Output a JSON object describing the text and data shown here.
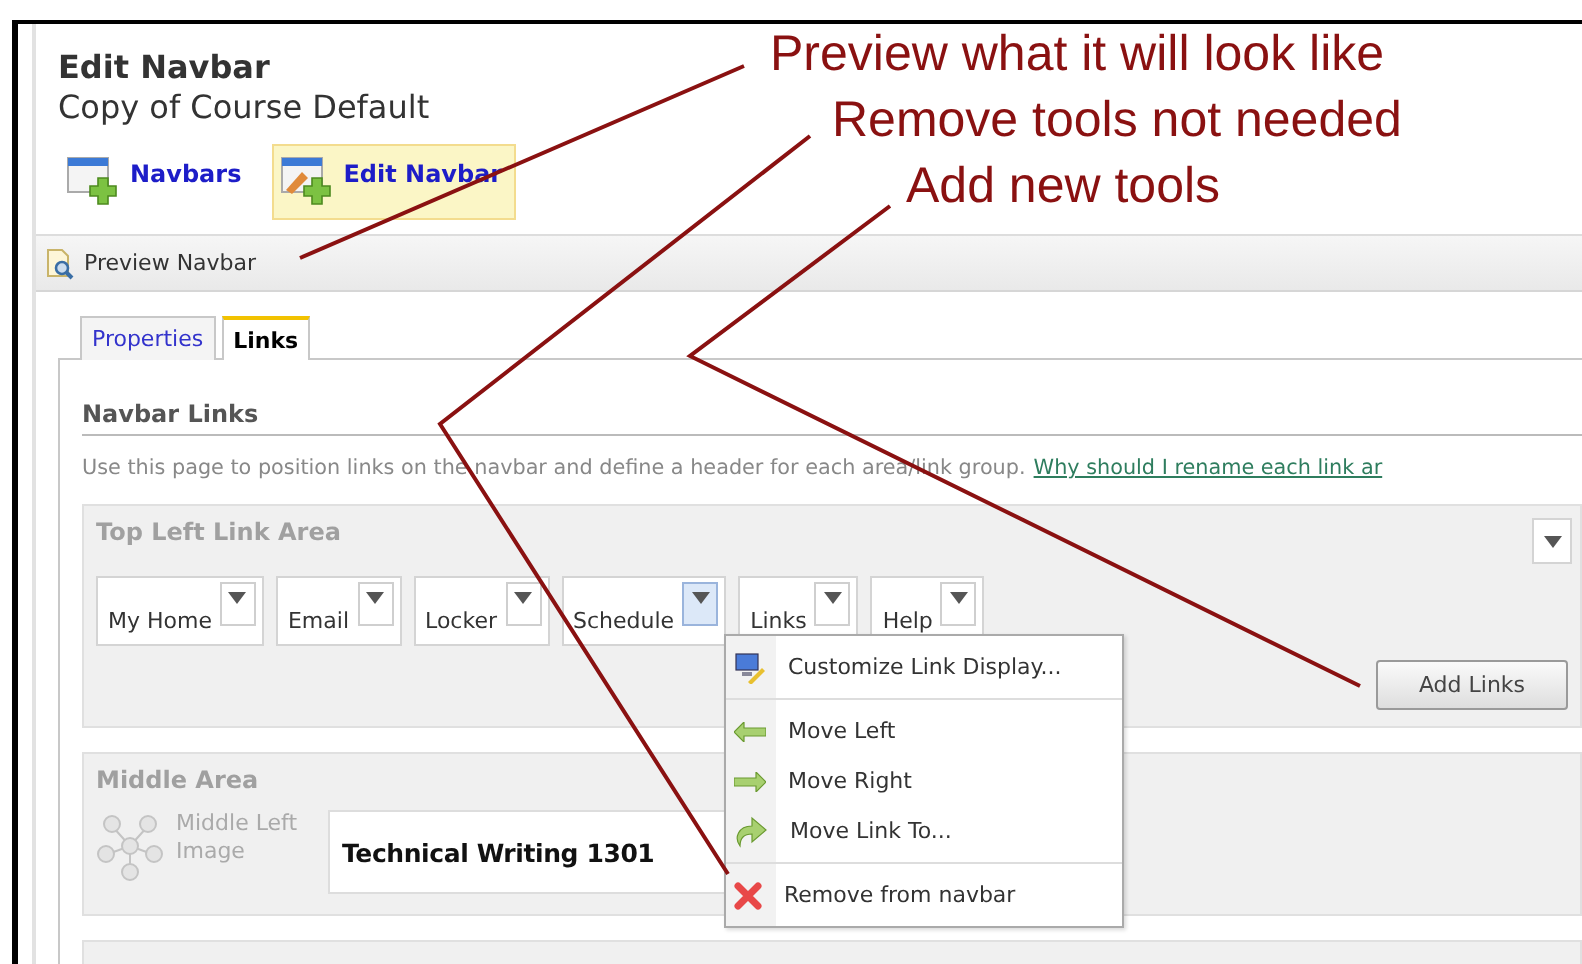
{
  "header": {
    "title": "Edit Navbar",
    "subtitle": "Copy of Course Default"
  },
  "nav_buttons": [
    {
      "label": "Navbars",
      "selected": false,
      "kind": "list"
    },
    {
      "label": "Edit Navbar",
      "selected": true,
      "kind": "edit"
    }
  ],
  "toolbar": {
    "preview": "Preview Navbar"
  },
  "tabs": [
    {
      "label": "Properties",
      "selected": false
    },
    {
      "label": "Links",
      "selected": true
    }
  ],
  "section": {
    "title": "Navbar Links",
    "description": "Use this page to position links on the navbar and define a header for each area/link group.",
    "help_link": "Why should I rename each link ar"
  },
  "top_area": {
    "title": "Top Left Link Area",
    "add_button": "Add Links",
    "links": [
      {
        "label": "My Home",
        "open": false
      },
      {
        "label": "Email",
        "open": false
      },
      {
        "label": "Locker",
        "open": false
      },
      {
        "label": "Schedule",
        "open": true
      },
      {
        "label": "Links",
        "open": false
      },
      {
        "label": "Help",
        "open": false
      }
    ]
  },
  "link_menu": {
    "groups": [
      [
        {
          "label": "Customize Link Display...",
          "kind": "customize"
        }
      ],
      [
        {
          "label": "Move Left",
          "kind": "left"
        },
        {
          "label": "Move Right",
          "kind": "right"
        },
        {
          "label": "Move Link To...",
          "kind": "moveto"
        }
      ],
      [
        {
          "label": "Remove from navbar",
          "kind": "remove"
        }
      ]
    ]
  },
  "middle_area": {
    "title": "Middle Area",
    "image_label": "Middle Left Image",
    "heading_value": "Technical Writing 1301"
  },
  "annotations": [
    {
      "text": "Preview what it will look like"
    },
    {
      "text": "Remove tools not needed"
    },
    {
      "text": "Add new tools"
    }
  ]
}
